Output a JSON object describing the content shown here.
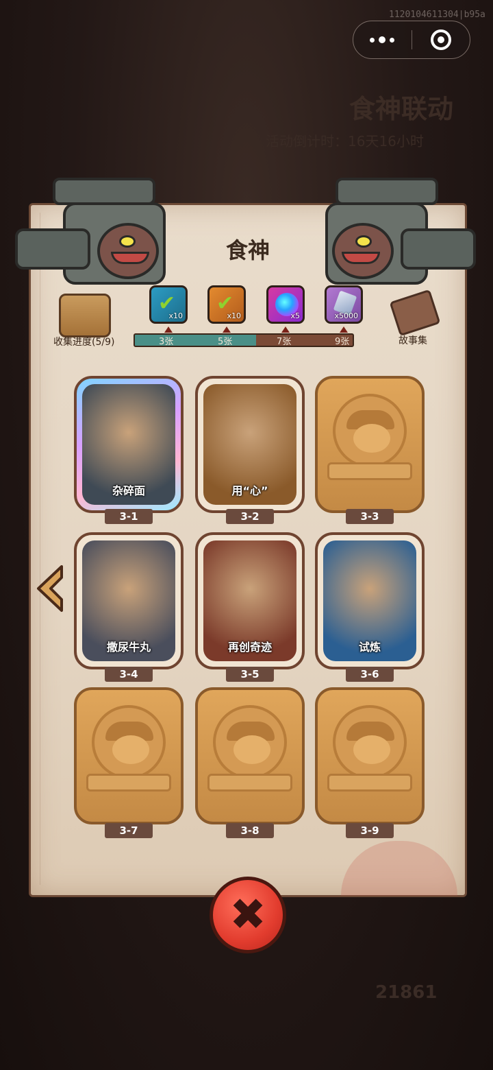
{
  "corner_id": "1120104611304|b95a",
  "background": {
    "event_title": "食神联动",
    "event_subtitle": "活动倒计时：16天16小时",
    "currency_value": "21861"
  },
  "popup": {
    "title": "食神",
    "collect_label": "收集进度(5/9)",
    "story_label": "故事集",
    "progress": {
      "collected": 5,
      "total": 9
    },
    "milestones": [
      {
        "label": "3张",
        "reward": "x10",
        "icon": "green-check-card-icon",
        "claimed": true
      },
      {
        "label": "5张",
        "reward": "x10",
        "icon": "orange-check-card-icon",
        "claimed": true
      },
      {
        "label": "7张",
        "reward": "x5",
        "icon": "magic-orb-icon",
        "claimed": false
      },
      {
        "label": "9张",
        "reward": "x5000",
        "icon": "crystal-gem-icon",
        "claimed": false
      }
    ],
    "cards": [
      {
        "id": "3-1",
        "name": "杂碎面",
        "unlocked": true,
        "holo": true
      },
      {
        "id": "3-2",
        "name": "用“心”",
        "unlocked": true,
        "holo": false
      },
      {
        "id": "3-3",
        "name": "",
        "unlocked": false,
        "holo": false
      },
      {
        "id": "3-4",
        "name": "撒尿牛丸",
        "unlocked": true,
        "holo": false
      },
      {
        "id": "3-5",
        "name": "再创奇迹",
        "unlocked": true,
        "holo": false
      },
      {
        "id": "3-6",
        "name": "试炼",
        "unlocked": true,
        "holo": false
      },
      {
        "id": "3-7",
        "name": "",
        "unlocked": false,
        "holo": false
      },
      {
        "id": "3-8",
        "name": "",
        "unlocked": false,
        "holo": false
      },
      {
        "id": "3-9",
        "name": "",
        "unlocked": false,
        "holo": false
      }
    ],
    "close_icon": "close-x-icon",
    "prev_icon": "left-arrow-icon"
  },
  "colors": {
    "bar_filled": "#4a8f87",
    "bar_empty": "#7b4a36",
    "close_red": "#e23c2e"
  }
}
